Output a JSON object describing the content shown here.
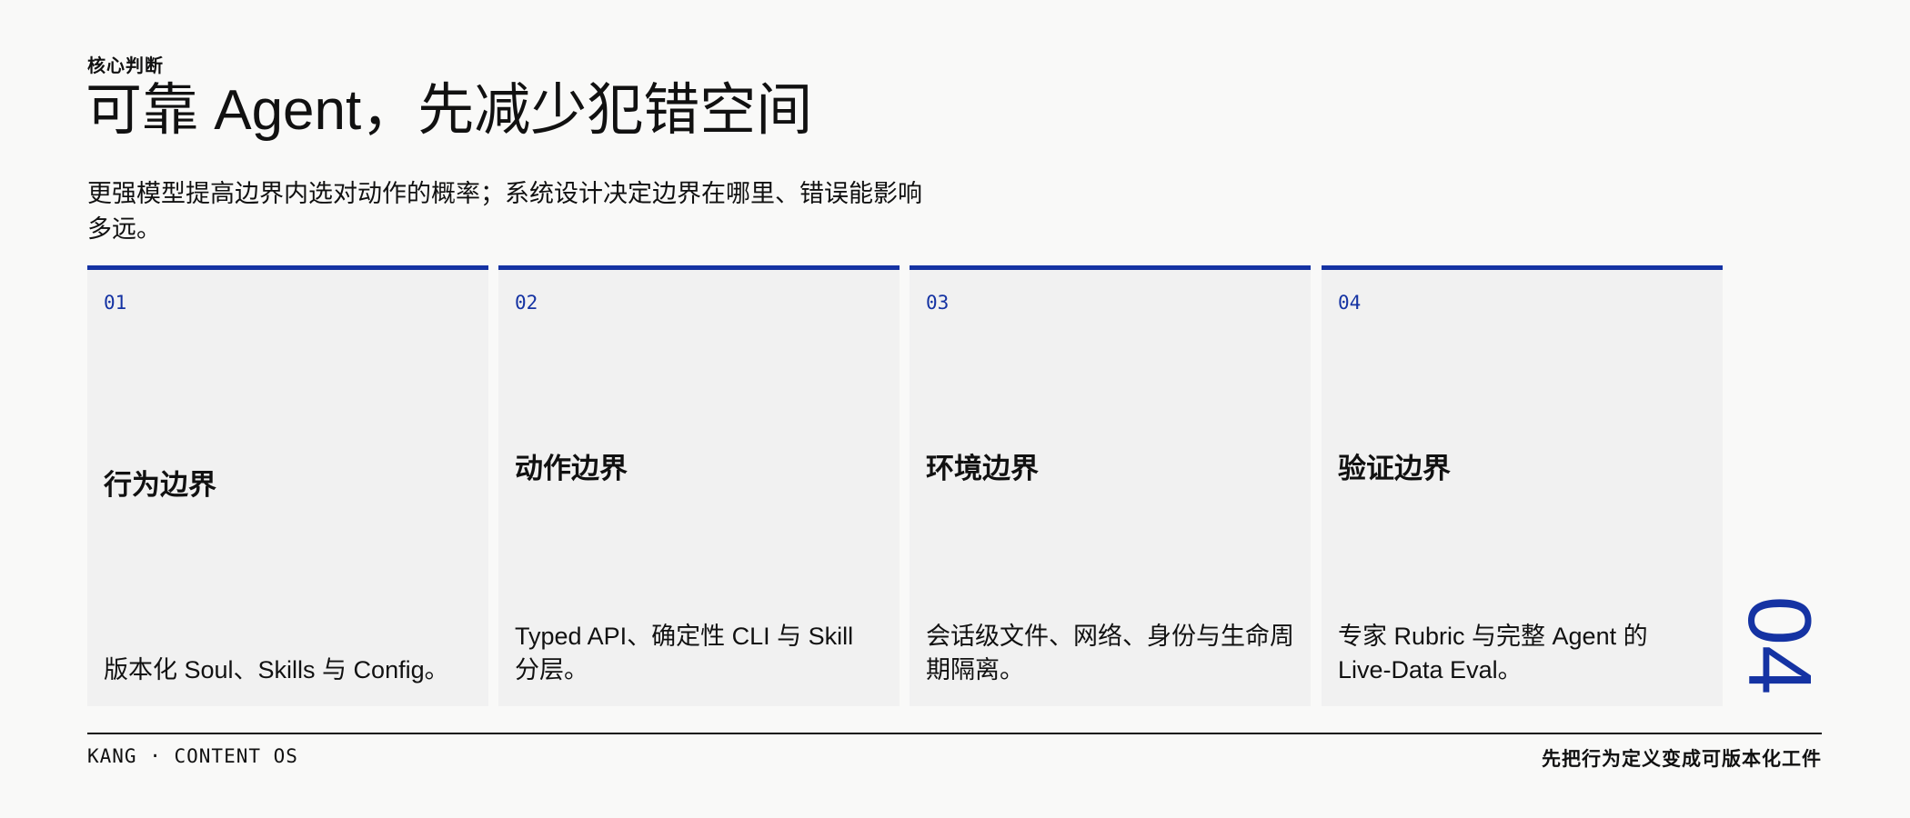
{
  "header": {
    "eyebrow": "核心判断",
    "title": "可靠 Agent，先减少犯错空间",
    "subtitle": "更强模型提高边界内选对动作的概率；系统设计决定边界在哪里、错误能影响多远。"
  },
  "cards": [
    {
      "number": "01",
      "title": "行为边界",
      "description": "版本化 Soul、Skills 与 Config。"
    },
    {
      "number": "02",
      "title": "动作边界",
      "description": "Typed API、确定性 CLI 与 Skill 分层。"
    },
    {
      "number": "03",
      "title": "环境边界",
      "description": "会话级文件、网络、身份与生命周期隔离。"
    },
    {
      "number": "04",
      "title": "验证边界",
      "description": "专家 Rubric 与完整 Agent 的 Live-Data Eval。"
    }
  ],
  "page_number": "04",
  "footer": {
    "left": "KANG · CONTENT OS",
    "right": "先把行为定义变成可版本化工件"
  },
  "colors": {
    "accent": "#1533a3",
    "text": "#111111",
    "background": "#f9f9f8",
    "card_background": "#f1f1f1"
  }
}
